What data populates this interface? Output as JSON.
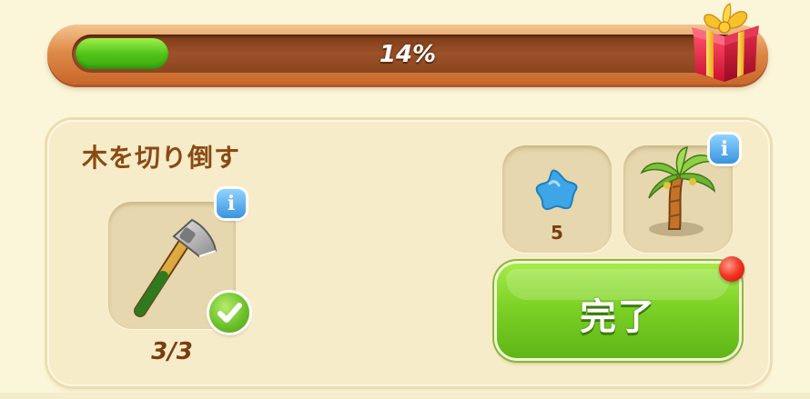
{
  "progress": {
    "percent_label": "14%",
    "value": 0.14,
    "fill_color": "#54c41b"
  },
  "reward": {
    "icon": "gift-box-icon"
  },
  "quest": {
    "title": "木を切り倒す",
    "tool": {
      "icon": "axe-icon",
      "count_label": "3/3",
      "completed": true
    },
    "rewards": [
      {
        "icon": "blue-star-icon",
        "count_label": "5"
      },
      {
        "icon": "palm-tree-icon"
      }
    ],
    "complete_button": {
      "label": "完了",
      "has_notification": true
    }
  },
  "colors": {
    "background": "#fbf6d9",
    "title": "#8a4a12",
    "button": "#7dd226",
    "notification": "#f2331f"
  }
}
